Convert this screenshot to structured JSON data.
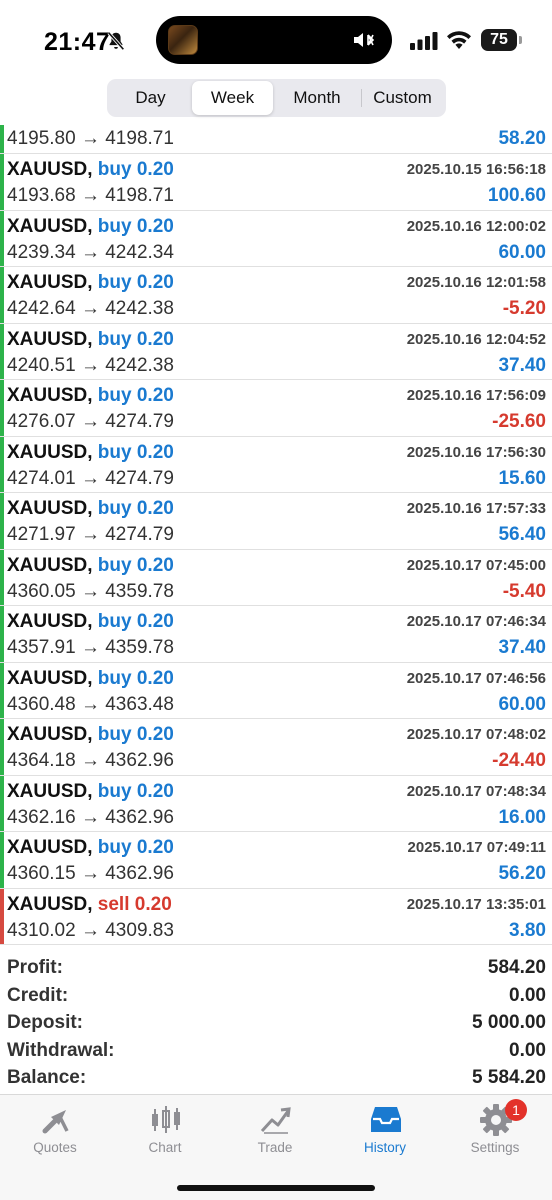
{
  "status_bar": {
    "time": "21:47",
    "battery": "75"
  },
  "periods": [
    "Day",
    "Week",
    "Month",
    "Custom"
  ],
  "active_period": "Week",
  "colors": {
    "buy": "#1a7ad0",
    "sell": "#d63a2e",
    "profit": "#1a7ad0",
    "loss": "#d63a2e",
    "bar_buy": "#2db34a",
    "bar_sell": "#d64a40"
  },
  "deals": [
    {
      "prices": "4195.80 → 4198.71",
      "profit": "58.20"
    },
    {
      "symbol": "XAUUSD",
      "side": "buy",
      "volume": "0.20",
      "time": "2025.10.15 16:56:18",
      "prices": "4193.68 → 4198.71",
      "profit": "100.60"
    },
    {
      "symbol": "XAUUSD",
      "side": "buy",
      "volume": "0.20",
      "time": "2025.10.16 12:00:02",
      "prices": "4239.34 → 4242.34",
      "profit": "60.00"
    },
    {
      "symbol": "XAUUSD",
      "side": "buy",
      "volume": "0.20",
      "time": "2025.10.16 12:01:58",
      "prices": "4242.64 → 4242.38",
      "profit": "-5.20"
    },
    {
      "symbol": "XAUUSD",
      "side": "buy",
      "volume": "0.20",
      "time": "2025.10.16 12:04:52",
      "prices": "4240.51 → 4242.38",
      "profit": "37.40"
    },
    {
      "symbol": "XAUUSD",
      "side": "buy",
      "volume": "0.20",
      "time": "2025.10.16 17:56:09",
      "prices": "4276.07 → 4274.79",
      "profit": "-25.60"
    },
    {
      "symbol": "XAUUSD",
      "side": "buy",
      "volume": "0.20",
      "time": "2025.10.16 17:56:30",
      "prices": "4274.01 → 4274.79",
      "profit": "15.60"
    },
    {
      "symbol": "XAUUSD",
      "side": "buy",
      "volume": "0.20",
      "time": "2025.10.16 17:57:33",
      "prices": "4271.97 → 4274.79",
      "profit": "56.40"
    },
    {
      "symbol": "XAUUSD",
      "side": "buy",
      "volume": "0.20",
      "time": "2025.10.17 07:45:00",
      "prices": "4360.05 → 4359.78",
      "profit": "-5.40"
    },
    {
      "symbol": "XAUUSD",
      "side": "buy",
      "volume": "0.20",
      "time": "2025.10.17 07:46:34",
      "prices": "4357.91 → 4359.78",
      "profit": "37.40"
    },
    {
      "symbol": "XAUUSD",
      "side": "buy",
      "volume": "0.20",
      "time": "2025.10.17 07:46:56",
      "prices": "4360.48 → 4363.48",
      "profit": "60.00"
    },
    {
      "symbol": "XAUUSD",
      "side": "buy",
      "volume": "0.20",
      "time": "2025.10.17 07:48:02",
      "prices": "4364.18 → 4362.96",
      "profit": "-24.40"
    },
    {
      "symbol": "XAUUSD",
      "side": "buy",
      "volume": "0.20",
      "time": "2025.10.17 07:48:34",
      "prices": "4362.16 → 4362.96",
      "profit": "16.00"
    },
    {
      "symbol": "XAUUSD",
      "side": "buy",
      "volume": "0.20",
      "time": "2025.10.17 07:49:11",
      "prices": "4360.15 → 4362.96",
      "profit": "56.20"
    },
    {
      "symbol": "XAUUSD",
      "side": "sell",
      "volume": "0.20",
      "time": "2025.10.17 13:35:01",
      "prices": "4310.02 → 4309.83",
      "profit": "3.80"
    }
  ],
  "summary": [
    {
      "label": "Profit:",
      "value": "584.20"
    },
    {
      "label": "Credit:",
      "value": "0.00"
    },
    {
      "label": "Deposit:",
      "value": "5 000.00"
    },
    {
      "label": "Withdrawal:",
      "value": "0.00"
    },
    {
      "label": "Balance:",
      "value": "5 584.20"
    }
  ],
  "tabs": [
    {
      "label": "Quotes",
      "icon": "quotes-icon"
    },
    {
      "label": "Chart",
      "icon": "chart-icon"
    },
    {
      "label": "Trade",
      "icon": "trade-icon"
    },
    {
      "label": "History",
      "icon": "history-icon",
      "active": true
    },
    {
      "label": "Settings",
      "icon": "settings-icon",
      "badge": "1"
    }
  ]
}
